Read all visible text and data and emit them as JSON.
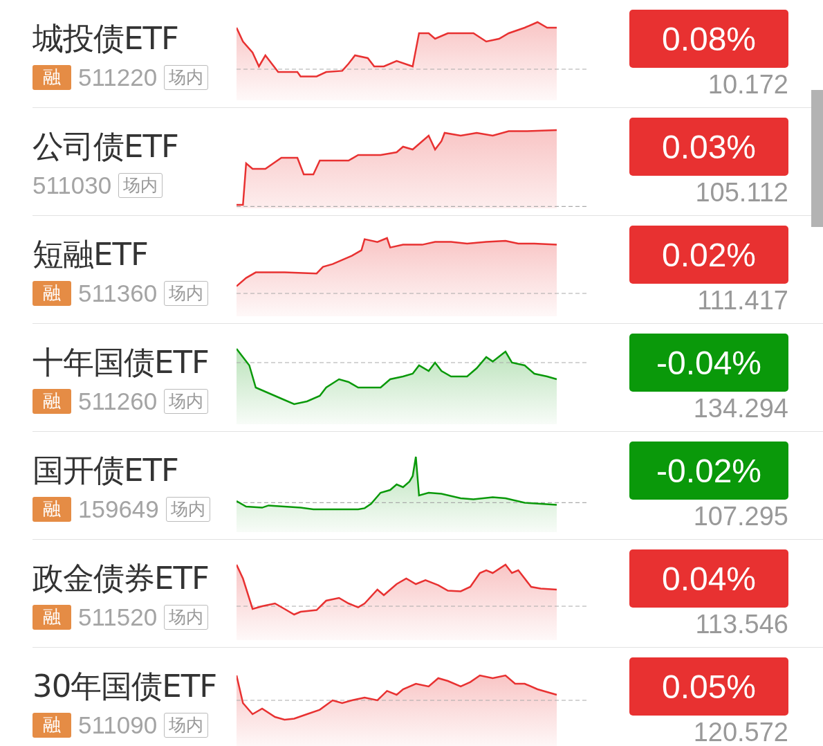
{
  "funds": [
    {
      "name": "城投债ETF",
      "margin_tag": "融",
      "code": "511220",
      "venue_tag": "场内",
      "change": "0.08%",
      "color": "#e83131",
      "price": "10.172"
    },
    {
      "name": "公司债ETF",
      "code": "511030",
      "venue_tag": "场内",
      "change": "0.03%",
      "color": "#e83131",
      "price": "105.112"
    },
    {
      "name": "短融ETF",
      "margin_tag": "融",
      "code": "511360",
      "venue_tag": "场内",
      "change": "0.02%",
      "color": "#e83131",
      "price": "111.417"
    },
    {
      "name": "十年国债ETF",
      "margin_tag": "融",
      "code": "511260",
      "venue_tag": "场内",
      "change": "-0.04%",
      "color": "#0a990a",
      "price": "134.294"
    },
    {
      "name": "国开债ETF",
      "margin_tag": "融",
      "code": "159649",
      "venue_tag": "场内",
      "change": "-0.02%",
      "color": "#0a990a",
      "price": "107.295"
    },
    {
      "name": "政金债券ETF",
      "margin_tag": "融",
      "code": "511520",
      "venue_tag": "场内",
      "change": "0.04%",
      "color": "#e83131",
      "price": "113.546"
    },
    {
      "name": "30年国债ETF",
      "margin_tag": "融",
      "code": "511090",
      "venue_tag": "场内",
      "change": "0.05%",
      "color": "#e83131",
      "price": "120.572"
    }
  ]
}
